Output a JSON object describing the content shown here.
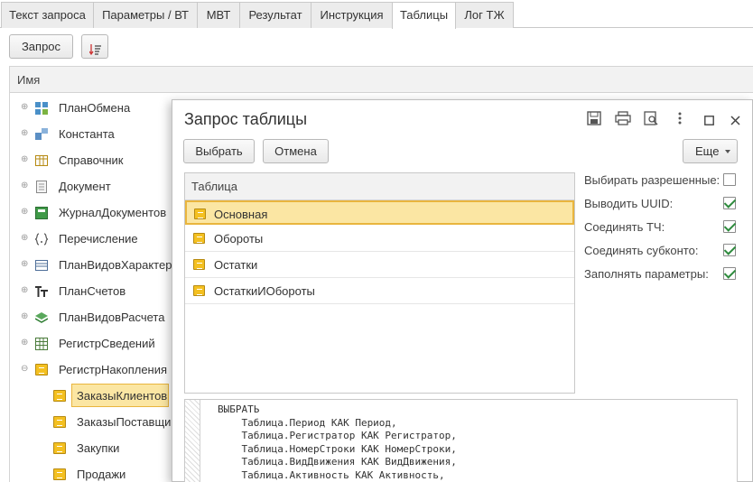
{
  "tabs": [
    "Текст запроса",
    "Параметры / ВТ",
    "МВТ",
    "Результат",
    "Инструкция",
    "Таблицы",
    "Лог ТЖ"
  ],
  "active_tab": "Таблицы",
  "toolbar": {
    "query_button": "Запрос",
    "sort_icon": "sort-list-icon"
  },
  "tree": {
    "header": "Имя",
    "items": [
      {
        "label": "ПланОбмена",
        "icon": "exchange-plan-icon",
        "expander": "⊕"
      },
      {
        "label": "Константа",
        "icon": "constant-icon",
        "expander": "⊕"
      },
      {
        "label": "Справочник",
        "icon": "catalog-icon",
        "expander": "⊕"
      },
      {
        "label": "Документ",
        "icon": "document-icon",
        "expander": "⊕"
      },
      {
        "label": "ЖурналДокументов",
        "icon": "document-journal-icon",
        "expander": "⊕"
      },
      {
        "label": "Перечисление",
        "icon": "enum-icon",
        "expander": "⊕"
      },
      {
        "label": "ПланВидовХарактери",
        "icon": "chart-of-characteristics-icon",
        "expander": "⊕"
      },
      {
        "label": "ПланСчетов",
        "icon": "chart-of-accounts-icon",
        "expander": "⊕"
      },
      {
        "label": "ПланВидовРасчета",
        "icon": "calculation-types-icon",
        "expander": "⊕"
      },
      {
        "label": "РегистрСведений",
        "icon": "info-register-icon",
        "expander": "⊕"
      },
      {
        "label": "РегистрНакопления",
        "icon": "accumulation-register-icon",
        "expander": "⊖"
      },
      {
        "label": "ЗаказыКлиентов",
        "icon": "register-icon",
        "expander": ""
      },
      {
        "label": "ЗаказыПоставщик",
        "icon": "register-icon",
        "expander": ""
      },
      {
        "label": "Закупки",
        "icon": "register-icon",
        "expander": ""
      },
      {
        "label": "Продажи",
        "icon": "register-icon",
        "expander": ""
      }
    ],
    "selected": "ЗаказыКлиентов"
  },
  "dialog": {
    "title": "Запрос таблицы",
    "icons": [
      "save-icon",
      "print-icon",
      "preview-icon",
      "more-icon",
      "maximize-icon",
      "close-icon"
    ],
    "select_button": "Выбрать",
    "cancel_button": "Отмена",
    "more_button": "Еще",
    "table": {
      "header": "Таблица",
      "rows": [
        "Основная",
        "Обороты",
        "Остатки",
        "ОстаткиИОбороты"
      ],
      "selected": "Основная"
    },
    "options": [
      {
        "label": "Выбирать разрешенные:",
        "checked": false
      },
      {
        "label": "Выводить UUID:",
        "checked": true
      },
      {
        "label": "Соединять ТЧ:",
        "checked": true
      },
      {
        "label": "Соединять субконто:",
        "checked": true
      },
      {
        "label": "Заполнять параметры:",
        "checked": true
      }
    ],
    "code": "ВЫБРАТЬ\n    Таблица.Период КАК Период,\n    Таблица.Регистратор КАК Регистратор,\n    Таблица.НомерСтроки КАК НомерСтроки,\n    Таблица.ВидДвижения КАК ВидДвижения,\n    Таблица.Активность КАК Активность,"
  },
  "colors": {
    "selection": "#fbe6a3",
    "selection_border": "#e9b53e",
    "check": "#2e8b3d"
  }
}
